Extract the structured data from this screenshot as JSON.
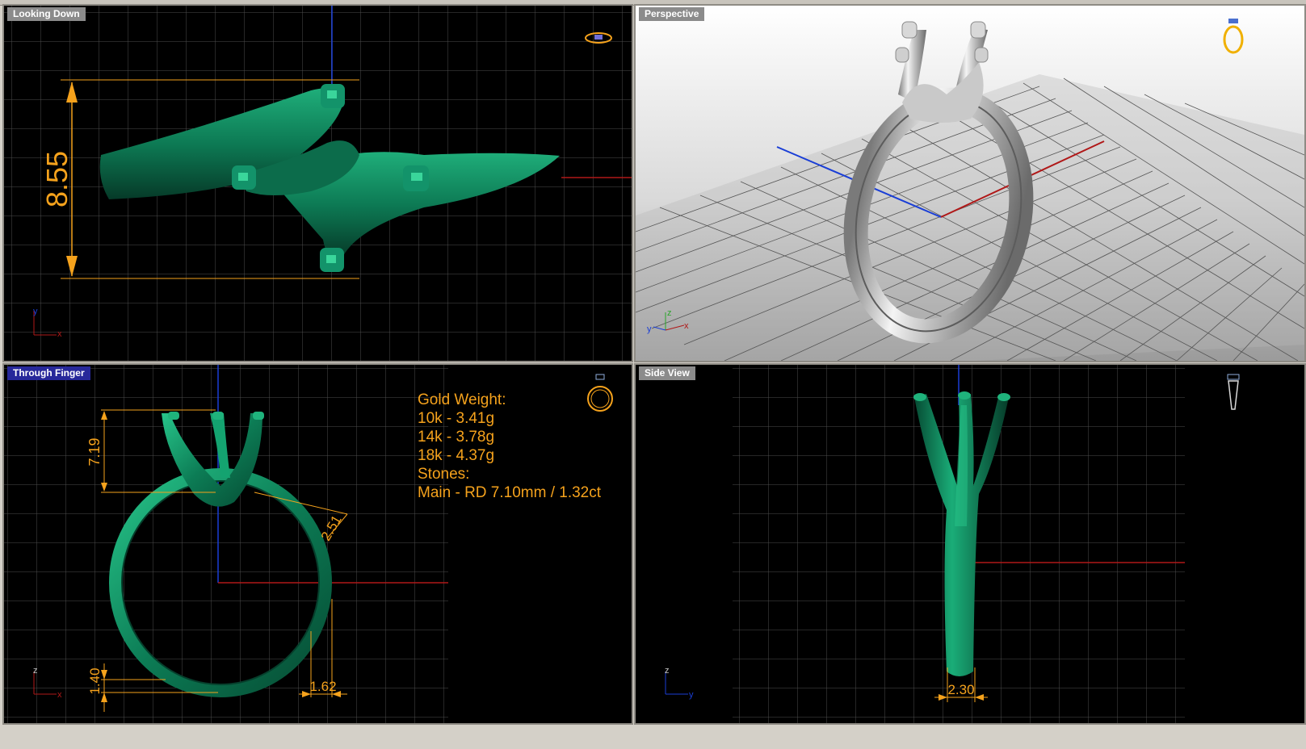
{
  "viewports": {
    "top_left": {
      "title": "Looking Down",
      "dimension": "8.55",
      "axes": {
        "y": "y",
        "x": "x"
      }
    },
    "top_right": {
      "title": "Perspective",
      "axes": {
        "z": "z",
        "y": "y",
        "x": "x"
      }
    },
    "bottom_left": {
      "title": "Through Finger",
      "dimensions": {
        "height": "7.19",
        "width_top": "2.51",
        "base": "1.40",
        "shank": "1.62"
      },
      "axes": {
        "z": "z",
        "x": "x"
      },
      "info": {
        "heading": "Gold Weight:",
        "weights": [
          "10k - 3.41g",
          "14k - 3.78g",
          "18k - 4.37g"
        ],
        "stones_heading": "Stones:",
        "stones": [
          "Main - RD 7.10mm / 1.32ct"
        ]
      }
    },
    "bottom_right": {
      "title": "Side View",
      "dimension": "2.30",
      "axes": {
        "z": "z",
        "y": "y"
      }
    }
  },
  "colors": {
    "ring_green": "#0e7d57",
    "dimension_orange": "#f5a21c",
    "grid": "#5a5a5a",
    "axis_red": "#b01818",
    "axis_blue": "#1a3ed6"
  },
  "icons": [
    "ring-top-icon",
    "ring-perspective-icon",
    "ring-front-icon",
    "ring-side-icon"
  ]
}
